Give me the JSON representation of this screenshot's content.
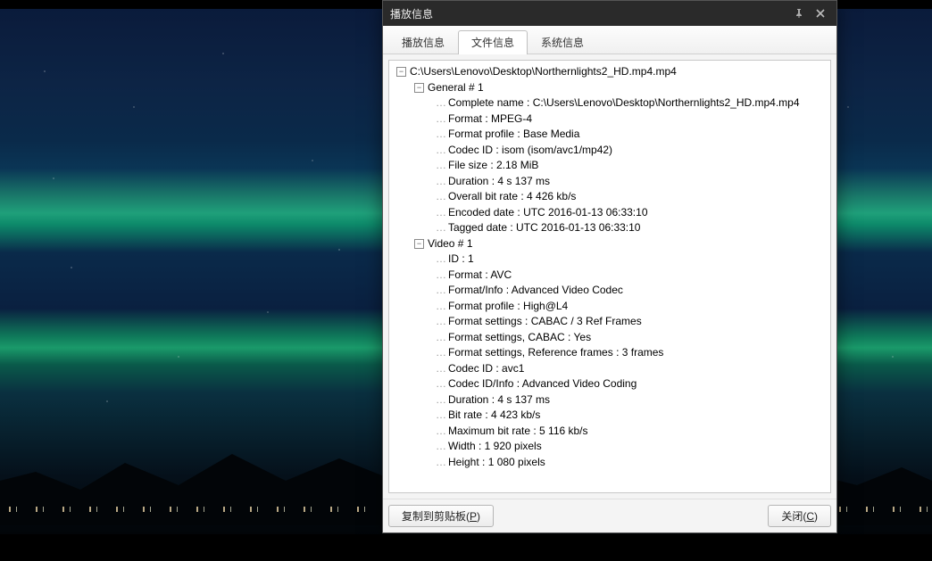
{
  "dialog": {
    "title": "播放信息",
    "tabs": [
      {
        "label": "播放信息",
        "active": false
      },
      {
        "label": "文件信息",
        "active": true
      },
      {
        "label": "系统信息",
        "active": false
      }
    ],
    "footer": {
      "copy_label": "复制到剪贴板",
      "copy_accel": "P",
      "close_label": "关闭",
      "close_accel": "C"
    }
  },
  "tree": {
    "root": "C:\\Users\\Lenovo\\Desktop\\Northernlights2_HD.mp4.mp4",
    "sections": [
      {
        "title": "General # 1",
        "items": [
          "Complete name : C:\\Users\\Lenovo\\Desktop\\Northernlights2_HD.mp4.mp4",
          "Format : MPEG-4",
          "Format profile : Base Media",
          "Codec ID : isom (isom/avc1/mp42)",
          "File size : 2.18 MiB",
          "Duration : 4 s 137 ms",
          "Overall bit rate : 4 426 kb/s",
          "Encoded date : UTC 2016-01-13 06:33:10",
          "Tagged date : UTC 2016-01-13 06:33:10"
        ]
      },
      {
        "title": "Video # 1",
        "items": [
          "ID : 1",
          "Format : AVC",
          "Format/Info : Advanced Video Codec",
          "Format profile : High@L4",
          "Format settings : CABAC / 3 Ref Frames",
          "Format settings, CABAC : Yes",
          "Format settings, Reference frames : 3 frames",
          "Codec ID : avc1",
          "Codec ID/Info : Advanced Video Coding",
          "Duration : 4 s 137 ms",
          "Bit rate : 4 423 kb/s",
          "Maximum bit rate : 5 116 kb/s",
          "Width : 1 920 pixels",
          "Height : 1 080 pixels"
        ]
      }
    ]
  }
}
